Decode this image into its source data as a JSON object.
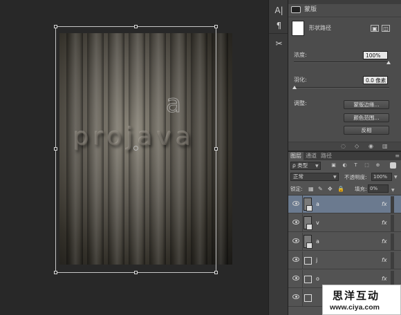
{
  "canvas": {
    "artwork_text": "projava",
    "artwork_text_ghost": "a"
  },
  "toolstrip": {
    "items": [
      {
        "icon": "character-icon",
        "glyph": "A|"
      },
      {
        "icon": "paragraph-icon",
        "glyph": "¶"
      },
      {
        "icon": "tools-icon",
        "glyph": "✂"
      }
    ]
  },
  "properties": {
    "header_label": "蒙版",
    "vector_mask_label": "形状路径",
    "density_label": "浓度:",
    "density_value": "100%",
    "feather_label": "羽化:",
    "feather_value": "0.0 像素",
    "adjust_label": "调整:",
    "buttons": {
      "mask_edge": "蒙版边缘...",
      "color_range": "颜色范围...",
      "invert": "反相"
    }
  },
  "layers": {
    "tabs": [
      "图层",
      "通道",
      "路径"
    ],
    "filter_kind": "ρ 类型",
    "filter_icons": [
      "image-filter-icon",
      "adjustment-filter-icon",
      "text-filter-icon",
      "shape-filter-icon",
      "smart-filter-icon"
    ],
    "filter_glyphs": [
      "▣",
      "◐",
      "T",
      "⬚",
      "⊕"
    ],
    "blend_mode": "正常",
    "opacity_label": "不透明度:",
    "opacity_value": "100%",
    "lock_label": "锁定:",
    "lock_icons": [
      "▦",
      "✎",
      "✥",
      "🔒"
    ],
    "fill_label": "填充:",
    "fill_value": "0%",
    "rows": [
      {
        "name": "a",
        "thumb": "smart",
        "selected": true,
        "fx": "fx"
      },
      {
        "name": "v",
        "thumb": "smart",
        "selected": false,
        "fx": "fx"
      },
      {
        "name": "a",
        "thumb": "smart",
        "selected": false,
        "fx": "fx"
      },
      {
        "name": "j",
        "thumb": "shape",
        "selected": false,
        "fx": "fx"
      },
      {
        "name": "o",
        "thumb": "shape",
        "selected": false,
        "fx": "fx"
      },
      {
        "name": "",
        "thumb": "shape",
        "selected": false,
        "fx": "fx"
      }
    ]
  },
  "watermark": {
    "title": "思洋互动",
    "url": "www.ciya.com"
  },
  "colors": {
    "selected_layer": "#6b7a8f",
    "panel_bg": "#535353",
    "canvas_bg": "#282828"
  }
}
